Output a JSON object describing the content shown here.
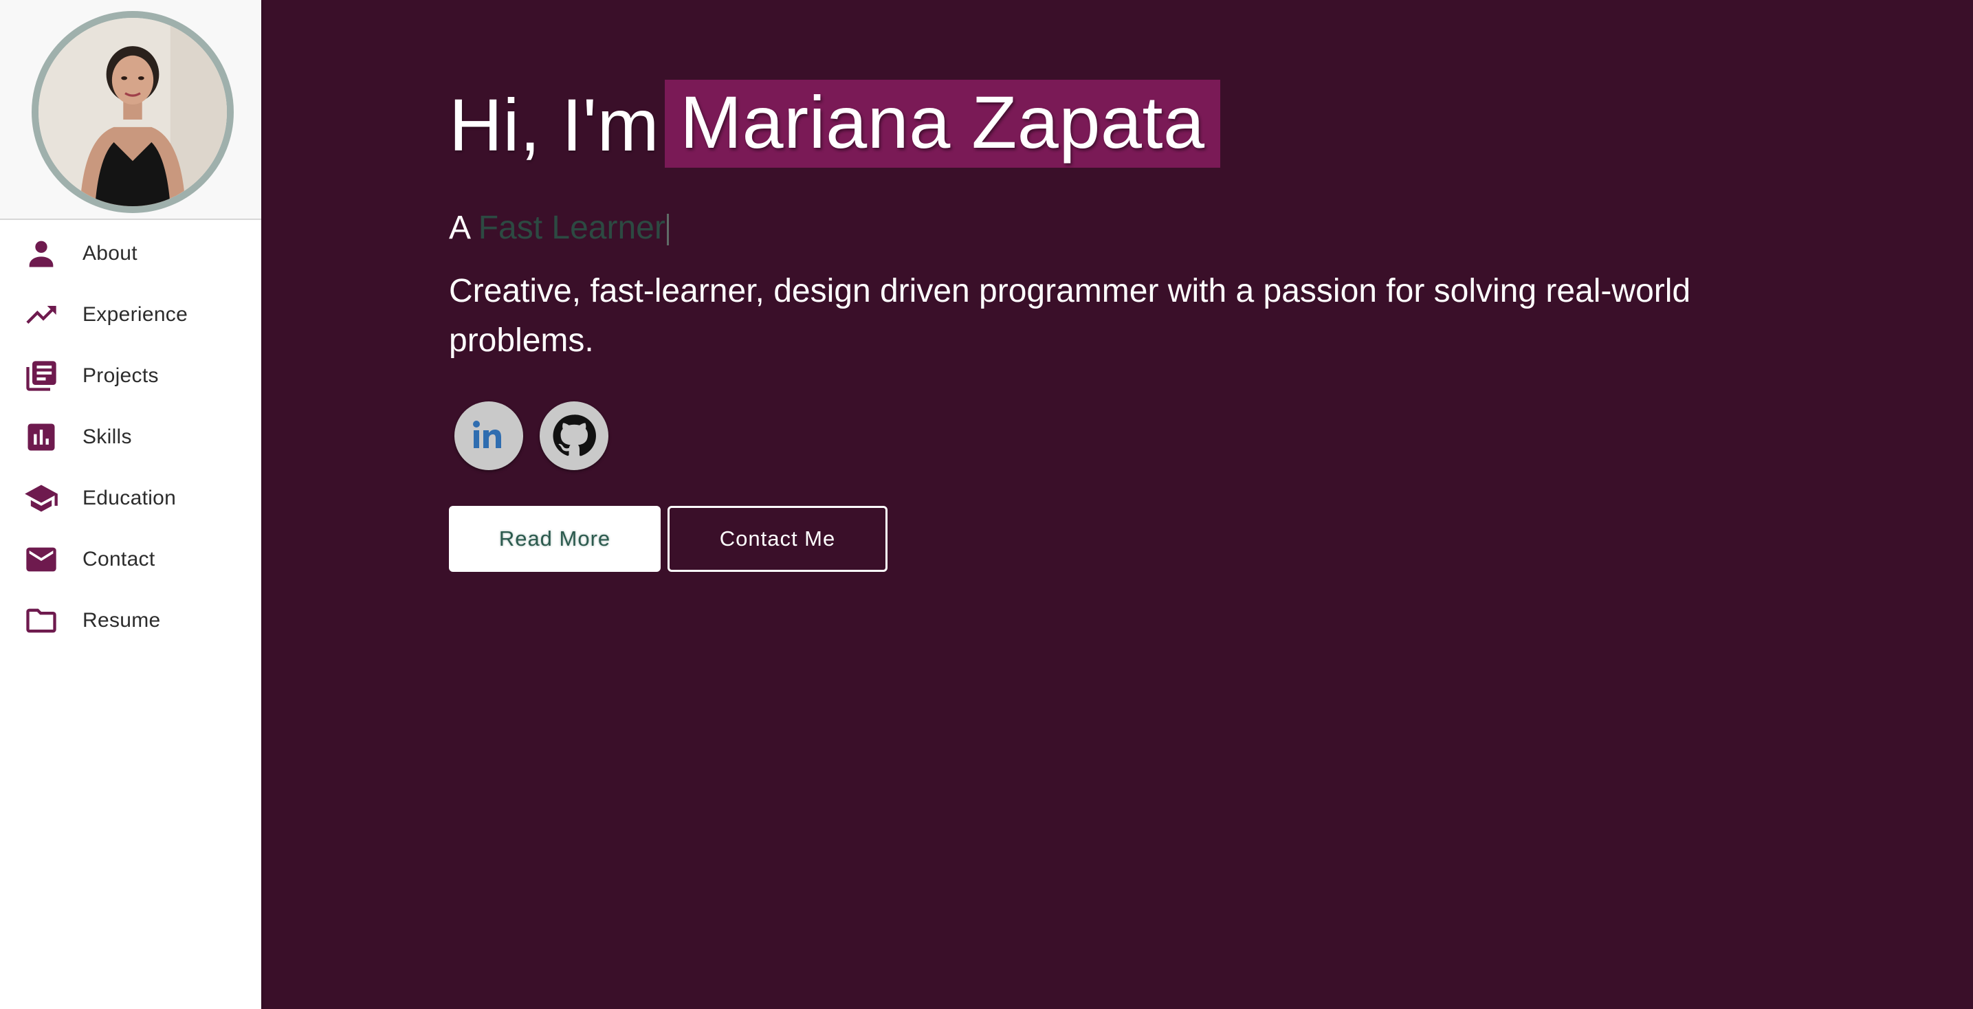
{
  "theme": {
    "main_background": "#3a0f29",
    "accent": "#7a1a56",
    "icon_color": "#6e1a4e",
    "typed_text_color": "#2c4a42"
  },
  "sidebar": {
    "avatar_alt": "profile-photo",
    "items": [
      {
        "label": "About",
        "icon": "person-icon"
      },
      {
        "label": "Experience",
        "icon": "trending-up-icon"
      },
      {
        "label": "Projects",
        "icon": "library-books-icon"
      },
      {
        "label": "Skills",
        "icon": "bar-chart-icon"
      },
      {
        "label": "Education",
        "icon": "school-icon"
      },
      {
        "label": "Contact",
        "icon": "mail-icon"
      },
      {
        "label": "Resume",
        "icon": "folder-icon"
      }
    ]
  },
  "hero": {
    "greeting": "Hi, I'm",
    "name": "Mariana Zapata",
    "tagline_prefix": "A",
    "tagline_typed": "Fast Learner",
    "bio": "Creative, fast-learner, design driven programmer with a passion for solving real-world problems.",
    "socials": [
      {
        "name": "linkedin-icon"
      },
      {
        "name": "github-icon"
      }
    ],
    "buttons": {
      "read_more": "Read More",
      "contact_me": "Contact Me"
    }
  }
}
